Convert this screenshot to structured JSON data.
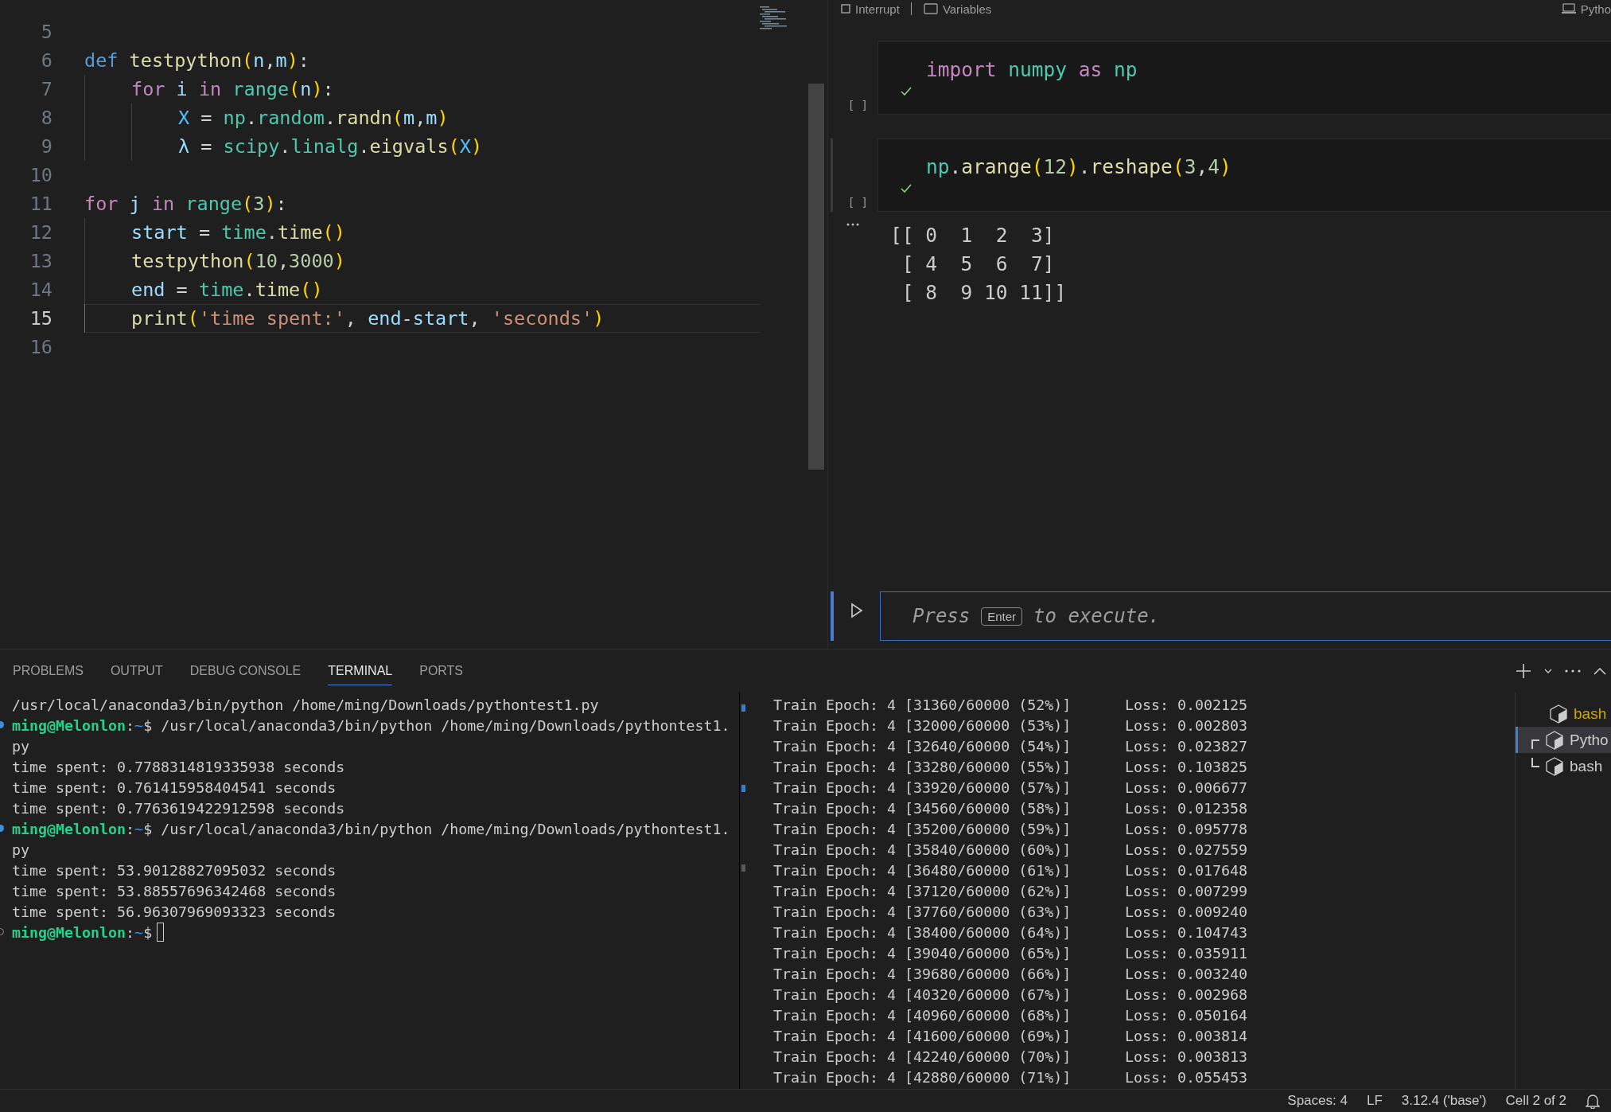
{
  "editor": {
    "lines": [
      {
        "number": "5"
      },
      {
        "number": "6",
        "tokens": [
          {
            "kind": "keyword",
            "text": "def "
          },
          {
            "kind": "function",
            "text": "testpython"
          },
          {
            "kind": "bracket",
            "text": "("
          },
          {
            "kind": "variable",
            "text": "n"
          },
          {
            "kind": "plain",
            "text": ","
          },
          {
            "kind": "variable",
            "text": "m"
          },
          {
            "kind": "bracket",
            "text": ")"
          },
          {
            "kind": "plain",
            "text": ":"
          }
        ],
        "children": [
          {
            "number": "7",
            "tokens": [
              {
                "kind": "control",
                "text": "for "
              },
              {
                "kind": "variable",
                "text": "i "
              },
              {
                "kind": "control",
                "text": "in "
              },
              {
                "kind": "module",
                "text": "range"
              },
              {
                "kind": "bracket",
                "text": "("
              },
              {
                "kind": "variable",
                "text": "n"
              },
              {
                "kind": "bracket",
                "text": ")"
              },
              {
                "kind": "plain",
                "text": ":"
              }
            ],
            "children": [
              {
                "number": "8",
                "tokens": [
                  {
                    "kind": "constant",
                    "text": "X"
                  },
                  {
                    "kind": "plain",
                    "text": " = "
                  },
                  {
                    "kind": "module",
                    "text": "np"
                  },
                  {
                    "kind": "plain",
                    "text": "."
                  },
                  {
                    "kind": "module",
                    "text": "random"
                  },
                  {
                    "kind": "plain",
                    "text": "."
                  },
                  {
                    "kind": "function",
                    "text": "randn"
                  },
                  {
                    "kind": "bracket",
                    "text": "("
                  },
                  {
                    "kind": "variable",
                    "text": "m"
                  },
                  {
                    "kind": "plain",
                    "text": ","
                  },
                  {
                    "kind": "variable",
                    "text": "m"
                  },
                  {
                    "kind": "bracket",
                    "text": ")"
                  }
                ]
              },
              {
                "number": "9",
                "tokens": [
                  {
                    "kind": "variable",
                    "text": "λ"
                  },
                  {
                    "kind": "plain",
                    "text": " = "
                  },
                  {
                    "kind": "module",
                    "text": "scipy"
                  },
                  {
                    "kind": "plain",
                    "text": "."
                  },
                  {
                    "kind": "module",
                    "text": "linalg"
                  },
                  {
                    "kind": "plain",
                    "text": "."
                  },
                  {
                    "kind": "function",
                    "text": "eigvals"
                  },
                  {
                    "kind": "bracket",
                    "text": "("
                  },
                  {
                    "kind": "constant",
                    "text": "X"
                  },
                  {
                    "kind": "bracket",
                    "text": ")"
                  }
                ]
              }
            ]
          }
        ]
      },
      {
        "number": "10"
      },
      {
        "number": "11",
        "tokens": [
          {
            "kind": "control",
            "text": "for "
          },
          {
            "kind": "variable",
            "text": "j "
          },
          {
            "kind": "control",
            "text": "in "
          },
          {
            "kind": "module",
            "text": "range"
          },
          {
            "kind": "bracket",
            "text": "("
          },
          {
            "kind": "number",
            "text": "3"
          },
          {
            "kind": "bracket",
            "text": ")"
          },
          {
            "kind": "plain",
            "text": ":"
          }
        ],
        "children": [
          {
            "number": "12",
            "tokens": [
              {
                "kind": "variable",
                "text": "start"
              },
              {
                "kind": "plain",
                "text": " = "
              },
              {
                "kind": "module",
                "text": "time"
              },
              {
                "kind": "plain",
                "text": "."
              },
              {
                "kind": "function",
                "text": "time"
              },
              {
                "kind": "bracket",
                "text": "()"
              }
            ]
          },
          {
            "number": "13",
            "tokens": [
              {
                "kind": "function",
                "text": "testpython"
              },
              {
                "kind": "bracket",
                "text": "("
              },
              {
                "kind": "number",
                "text": "10"
              },
              {
                "kind": "plain",
                "text": ","
              },
              {
                "kind": "number",
                "text": "3000"
              },
              {
                "kind": "bracket",
                "text": ")"
              }
            ]
          },
          {
            "number": "14",
            "tokens": [
              {
                "kind": "variable",
                "text": "end"
              },
              {
                "kind": "plain",
                "text": " = "
              },
              {
                "kind": "module",
                "text": "time"
              },
              {
                "kind": "plain",
                "text": "."
              },
              {
                "kind": "function",
                "text": "time"
              },
              {
                "kind": "bracket",
                "text": "()"
              }
            ]
          },
          {
            "number": "15",
            "current": true,
            "tokens": [
              {
                "kind": "function",
                "text": "print"
              },
              {
                "kind": "bracket",
                "text": "("
              },
              {
                "kind": "string",
                "text": "'time spent:'"
              },
              {
                "kind": "plain",
                "text": ", "
              },
              {
                "kind": "variable",
                "text": "end"
              },
              {
                "kind": "plain",
                "text": "-"
              },
              {
                "kind": "variable",
                "text": "start"
              },
              {
                "kind": "plain",
                "text": ", "
              },
              {
                "kind": "string",
                "text": "'seconds'"
              },
              {
                "kind": "bracket",
                "text": ")"
              }
            ]
          }
        ]
      },
      {
        "number": "16"
      }
    ]
  },
  "notebook": {
    "toolbar": {
      "interrupt": "Interrupt",
      "variables": "Variables",
      "kernel": "Pytho"
    },
    "cells": [
      {
        "exec_label": "[ ]",
        "succeeded": true,
        "focused": false,
        "tokens": [
          {
            "kind": "control",
            "text": "import "
          },
          {
            "kind": "module",
            "text": "numpy "
          },
          {
            "kind": "control",
            "text": "as "
          },
          {
            "kind": "module",
            "text": "np"
          }
        ]
      },
      {
        "exec_label": "[ ]",
        "succeeded": true,
        "focused": true,
        "tokens": [
          {
            "kind": "module",
            "text": "np"
          },
          {
            "kind": "plain",
            "text": "."
          },
          {
            "kind": "function",
            "text": "arange"
          },
          {
            "kind": "bracket",
            "text": "("
          },
          {
            "kind": "number",
            "text": "12"
          },
          {
            "kind": "bracket",
            "text": ")"
          },
          {
            "kind": "plain",
            "text": "."
          },
          {
            "kind": "function",
            "text": "reshape"
          },
          {
            "kind": "bracket",
            "text": "("
          },
          {
            "kind": "number",
            "text": "3"
          },
          {
            "kind": "plain",
            "text": ","
          },
          {
            "kind": "number",
            "text": "4"
          },
          {
            "kind": "bracket",
            "text": ")"
          }
        ],
        "output": [
          "[[ 0  1  2  3]",
          " [ 4  5  6  7]",
          " [ 8  9 10 11]]"
        ]
      }
    ],
    "input": {
      "before": "Press",
      "key": "Enter",
      "after": "to execute."
    }
  },
  "panel": {
    "tabs": [
      {
        "label": "PROBLEMS",
        "selected": false
      },
      {
        "label": "OUTPUT",
        "selected": false
      },
      {
        "label": "DEBUG CONSOLE",
        "selected": false
      },
      {
        "label": "TERMINAL",
        "selected": true
      },
      {
        "label": "PORTS",
        "selected": false
      }
    ],
    "terminal_left": [
      {
        "kind": "plain",
        "text": "/usr/local/anaconda3/bin/python /home/ming/Downloads/pythontest1.py"
      },
      {
        "kind": "prompt",
        "user": "ming@Melonlon",
        "sep": ":",
        "path": "~",
        "command": "$ /usr/local/anaconda3/bin/python /home/ming/Downloads/pythontest1.",
        "done": true
      },
      {
        "kind": "plain",
        "text": "py"
      },
      {
        "kind": "plain",
        "text": "time spent: 0.7788314819335938 seconds"
      },
      {
        "kind": "plain",
        "text": "time spent: 0.761415958404541 seconds"
      },
      {
        "kind": "plain",
        "text": "time spent: 0.7763619422912598 seconds"
      },
      {
        "kind": "prompt",
        "user": "ming@Melonlon",
        "sep": ":",
        "path": "~",
        "command": "$ /usr/local/anaconda3/bin/python /home/ming/Downloads/pythontest1.",
        "done": true
      },
      {
        "kind": "plain",
        "text": "py"
      },
      {
        "kind": "plain",
        "text": "time spent: 53.90128827095032 seconds"
      },
      {
        "kind": "plain",
        "text": "time spent: 53.88557696342468 seconds"
      },
      {
        "kind": "plain",
        "text": "time spent: 56.96307969093323 seconds"
      },
      {
        "kind": "prompt",
        "user": "ming@Melonlon",
        "sep": ":",
        "path": "~",
        "command": "$",
        "done": false,
        "cursor": true
      }
    ],
    "terminal_right": [
      {
        "progress": "Train Epoch: 4 [31360/60000 (52%)]",
        "loss": "Loss: 0.002125"
      },
      {
        "progress": "Train Epoch: 4 [32000/60000 (53%)]",
        "loss": "Loss: 0.002803"
      },
      {
        "progress": "Train Epoch: 4 [32640/60000 (54%)]",
        "loss": "Loss: 0.023827"
      },
      {
        "progress": "Train Epoch: 4 [33280/60000 (55%)]",
        "loss": "Loss: 0.103825"
      },
      {
        "progress": "Train Epoch: 4 [33920/60000 (57%)]",
        "loss": "Loss: 0.006677"
      },
      {
        "progress": "Train Epoch: 4 [34560/60000 (58%)]",
        "loss": "Loss: 0.012358"
      },
      {
        "progress": "Train Epoch: 4 [35200/60000 (59%)]",
        "loss": "Loss: 0.095778"
      },
      {
        "progress": "Train Epoch: 4 [35840/60000 (60%)]",
        "loss": "Loss: 0.027559"
      },
      {
        "progress": "Train Epoch: 4 [36480/60000 (61%)]",
        "loss": "Loss: 0.017648"
      },
      {
        "progress": "Train Epoch: 4 [37120/60000 (62%)]",
        "loss": "Loss: 0.007299"
      },
      {
        "progress": "Train Epoch: 4 [37760/60000 (63%)]",
        "loss": "Loss: 0.009240"
      },
      {
        "progress": "Train Epoch: 4 [38400/60000 (64%)]",
        "loss": "Loss: 0.104743"
      },
      {
        "progress": "Train Epoch: 4 [39040/60000 (65%)]",
        "loss": "Loss: 0.035911"
      },
      {
        "progress": "Train Epoch: 4 [39680/60000 (66%)]",
        "loss": "Loss: 0.003240"
      },
      {
        "progress": "Train Epoch: 4 [40320/60000 (67%)]",
        "loss": "Loss: 0.002968"
      },
      {
        "progress": "Train Epoch: 4 [40960/60000 (68%)]",
        "loss": "Loss: 0.050164"
      },
      {
        "progress": "Train Epoch: 4 [41600/60000 (69%)]",
        "loss": "Loss: 0.003814"
      },
      {
        "progress": "Train Epoch: 4 [42240/60000 (70%)]",
        "loss": "Loss: 0.003813"
      },
      {
        "progress": "Train Epoch: 4 [42880/60000 (71%)]",
        "loss": "Loss: 0.055453"
      }
    ],
    "terminals": [
      {
        "label": "bash",
        "kind": "single",
        "selected": false,
        "color": "#cca700"
      },
      {
        "label": "Pytho",
        "kind": "split-top",
        "selected": true,
        "color": "#cccccc"
      },
      {
        "label": "bash",
        "kind": "split-bottom",
        "selected": false,
        "color": "#cccccc"
      }
    ]
  },
  "status_bar": {
    "items": [
      "Spaces: 4",
      "LF",
      "3.12.4 ('base')",
      "Cell 2 of 2"
    ]
  }
}
